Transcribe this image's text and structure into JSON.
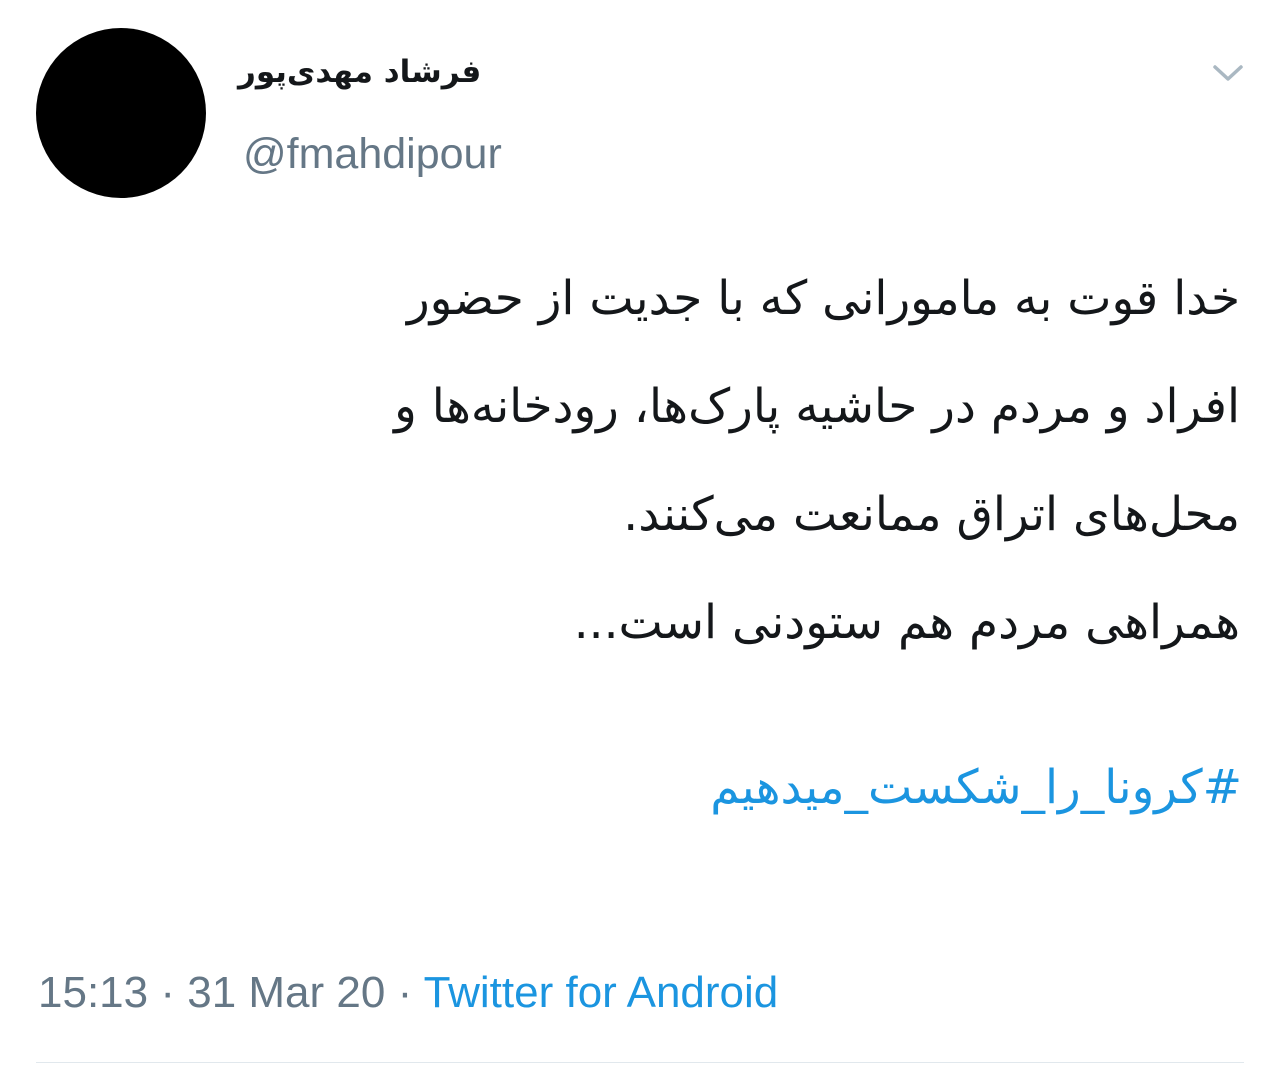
{
  "author": {
    "display_name": "فرشاد مهدی‌پور",
    "handle": "@fmahdipour"
  },
  "tweet": {
    "lines": [
      "خدا قوت به مامورانی که با جدیت از حضور",
      "افراد و مردم در حاشیه پارک‌ها، رودخانه‌ها و",
      "محل‌های اتراق ممانعت می‌کنند.",
      "همراهی مردم هم ستودنی است..."
    ],
    "hashtag": "#کرونا_را_شکست_میدهیم"
  },
  "meta": {
    "time": "15:13",
    "separator": "·",
    "date": "31 Mar 20",
    "source": "Twitter for Android"
  },
  "icons": {
    "menu": "chevron-down-icon"
  },
  "colors": {
    "link": "#1b95e0",
    "secondary_text": "#657786",
    "primary_text": "#14171a",
    "avatar": "#000000",
    "divider": "#e1e8ed"
  }
}
